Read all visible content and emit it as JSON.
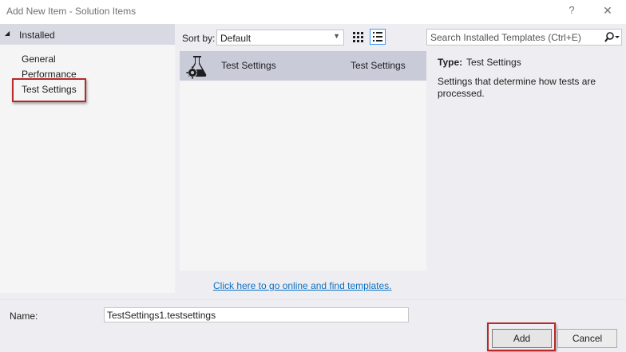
{
  "window": {
    "title": "Add New Item - Solution Items",
    "help_glyph": "?",
    "close_glyph": "✕"
  },
  "tree": {
    "header": "Installed",
    "arrow": "◢",
    "items": [
      {
        "label": "General"
      },
      {
        "label": "Performance"
      },
      {
        "label": "Test Settings"
      }
    ]
  },
  "sort": {
    "label": "Sort by:",
    "value": "Default"
  },
  "search": {
    "placeholder": "Search Installed Templates (Ctrl+E)"
  },
  "templates": [
    {
      "name": "Test Settings",
      "type": "Test Settings",
      "icon": "flask-gear-icon"
    }
  ],
  "online_link": "Click here to go online and find templates.",
  "details": {
    "type_label": "Type:",
    "type_value": "Test Settings",
    "description": "Settings that determine how tests are processed."
  },
  "name_field": {
    "label": "Name:",
    "value": "TestSettings1.testsettings"
  },
  "buttons": {
    "add": "Add",
    "cancel": "Cancel"
  },
  "colors": {
    "highlight": "#b62a2a",
    "selected_row": "#c9cbd9",
    "link": "#0e70c0"
  }
}
